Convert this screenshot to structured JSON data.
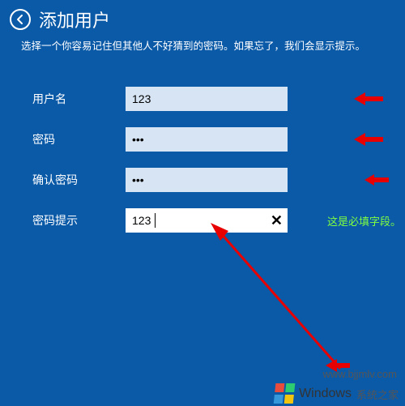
{
  "header": {
    "title": "添加用户",
    "subtitle": "选择一个你容易记住但其他人不好猜到的密码。如果忘了，我们会显示提示。"
  },
  "form": {
    "username": {
      "label": "用户名",
      "value": "123"
    },
    "password": {
      "label": "密码",
      "value": "•••"
    },
    "confirm": {
      "label": "确认密码",
      "value": "•••"
    },
    "hint": {
      "label": "密码提示",
      "value": "123",
      "message": "这是必填字段。"
    }
  },
  "watermark": "www.bjjmlv.com",
  "brand": {
    "name": "Windows",
    "suffix": "系统之家"
  }
}
